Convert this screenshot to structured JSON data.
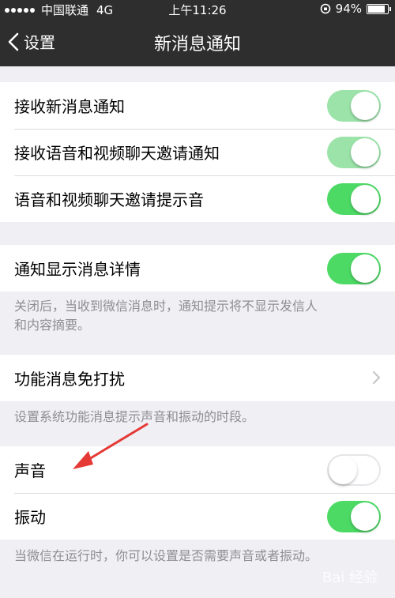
{
  "status": {
    "carrier": "中国联通",
    "network": "4G",
    "time": "上午11:26",
    "battery": "94%",
    "battery_level": 0.94
  },
  "nav": {
    "back_label": "设置",
    "title": "新消息通知"
  },
  "group1": [
    {
      "label": "接收新消息通知",
      "on": true,
      "dim": true
    },
    {
      "label": "接收语音和视频聊天邀请通知",
      "on": true,
      "dim": true
    },
    {
      "label": "语音和视频聊天邀请提示音",
      "on": true,
      "dim": false
    }
  ],
  "group2": {
    "label": "通知显示消息详情",
    "on": true,
    "note_line1": "关闭后，当收到微信消息时，通知提示将不显示发信人",
    "note_line2": "和内容摘要。"
  },
  "group3": {
    "label": "功能消息免打扰",
    "note": "设置系统功能消息提示声音和振动的时段。"
  },
  "group4": [
    {
      "label": "声音",
      "on": false
    },
    {
      "label": "振动",
      "on": true
    }
  ],
  "footer_note": "当微信在运行时，你可以设置是否需要声音或者振动。",
  "watermark": "Bai 经验",
  "colors": {
    "toggle_on": "#4cd964",
    "toggle_on_dim": "#9be3a9",
    "annotation_arrow": "#e53935",
    "bar": "#2e2e2e"
  }
}
